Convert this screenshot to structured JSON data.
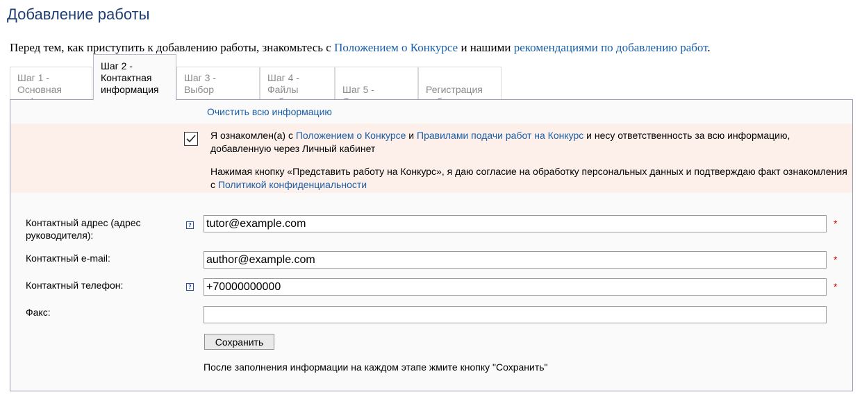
{
  "page": {
    "title": "Добавление работы",
    "intro": {
      "before": "Перед тем, как приступить к добавлению работы, знакомьтесь с ",
      "link1": "Положением о Конкурсе",
      "middle": " и нашими ",
      "link2": "рекомендациями по добавлению работ",
      "after": "."
    }
  },
  "tabs": [
    {
      "line1": "Шаг 1 -",
      "line2": "Основная",
      "line3": "информация",
      "active": false
    },
    {
      "line1": "Шаг 2 -",
      "line2": "Контактная",
      "line3": "информация",
      "active": true
    },
    {
      "line1": "Шаг 3 -",
      "line2": "Выбор",
      "line3": "организации",
      "active": false
    },
    {
      "line1": "Шаг 4 -",
      "line2": "Файлы",
      "line3": "работы",
      "active": false
    },
    {
      "line1": "Шаг 5 -",
      "line2": "Олимпиада",
      "line3": "",
      "active": false
    },
    {
      "line1": "Регистрация",
      "line2": "работы",
      "line3": "",
      "active": false
    }
  ],
  "panel": {
    "clear_link": "Очистить всю информацию",
    "consent": {
      "checked": true,
      "p1_before": "Я ознакомлен(а) с ",
      "p1_link1": "Положением о Конкурсе",
      "p1_mid": " и ",
      "p1_link2": "Правилами подачи работ на Конкурс",
      "p1_after": " и несу ответственность за всю информацию, добавленную через Личный кабинет",
      "p2_before": "Нажимая кнопку «Представить работу на Конкурс», я даю согласие на обработку персональных данных и подтверждаю факт ознакомления с ",
      "p2_link": "Политикой конфиденциальности"
    },
    "fields": [
      {
        "label": "Контактный адрес (адрес руководителя):",
        "value": "tutor@example.com",
        "help_icon": "question-icon",
        "required": "*"
      },
      {
        "label": "Контактный e-mail:",
        "value": "author@example.com",
        "help_icon": "",
        "required": "*"
      },
      {
        "label": "Контактный телефон:",
        "value": "+70000000000",
        "help_icon": "question-icon",
        "required": "*"
      },
      {
        "label": "Факс:",
        "value": "",
        "help_icon": "",
        "required": ""
      }
    ],
    "save_button": "Сохранить",
    "hint": "После заполнения информации на каждом этапе жмите кнопку \"Сохранить\""
  },
  "colors": {
    "title": "#1f3f73",
    "link": "#1a5ea8",
    "consent_background": "#fdf0ea",
    "required": "#d40000"
  }
}
